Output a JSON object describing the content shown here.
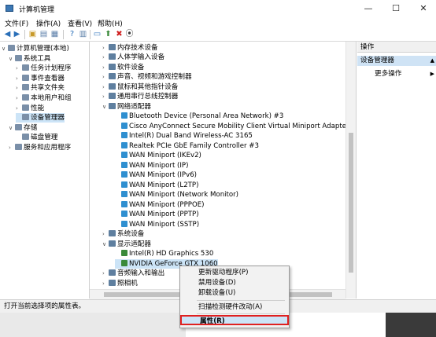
{
  "window": {
    "title": "计算机管理",
    "controls": [
      "—",
      "☐",
      "✕"
    ]
  },
  "menubar": [
    "文件(F)",
    "操作(A)",
    "查看(V)",
    "帮助(H)"
  ],
  "left_tree": [
    {
      "label": "计算机管理(本地)",
      "indent": 0,
      "exp": "∨"
    },
    {
      "label": "系统工具",
      "indent": 1,
      "exp": "∨"
    },
    {
      "label": "任务计划程序",
      "indent": 2,
      "exp": "›"
    },
    {
      "label": "事件查看器",
      "indent": 2,
      "exp": "›"
    },
    {
      "label": "共享文件夹",
      "indent": 2,
      "exp": "›"
    },
    {
      "label": "本地用户和组",
      "indent": 2,
      "exp": "›"
    },
    {
      "label": "性能",
      "indent": 2,
      "exp": "›"
    },
    {
      "label": "设备管理器",
      "indent": 2,
      "exp": "",
      "selected": true
    },
    {
      "label": "存储",
      "indent": 1,
      "exp": "∨"
    },
    {
      "label": "磁盘管理",
      "indent": 2,
      "exp": ""
    },
    {
      "label": "服务和应用程序",
      "indent": 1,
      "exp": "›"
    }
  ],
  "device_tree": [
    {
      "label": "内存技术设备",
      "indent": 0,
      "exp": "›"
    },
    {
      "label": "人体学输入设备",
      "indent": 0,
      "exp": "›"
    },
    {
      "label": "软件设备",
      "indent": 0,
      "exp": "›"
    },
    {
      "label": "声音、视频和游戏控制器",
      "indent": 0,
      "exp": "›"
    },
    {
      "label": "鼠标和其他指针设备",
      "indent": 0,
      "exp": "›"
    },
    {
      "label": "通用串行总线控制器",
      "indent": 0,
      "exp": "›"
    },
    {
      "label": "网络适配器",
      "indent": 0,
      "exp": "∨"
    },
    {
      "label": "Bluetooth Device (Personal Area Network) #3",
      "indent": 1,
      "exp": "",
      "icon": "net"
    },
    {
      "label": "Cisco AnyConnect Secure Mobility Client Virtual Miniport Adapte",
      "indent": 1,
      "exp": "",
      "icon": "net"
    },
    {
      "label": "Intel(R) Dual Band Wireless-AC 3165",
      "indent": 1,
      "exp": "",
      "icon": "net"
    },
    {
      "label": "Realtek PCIe GbE Family Controller #3",
      "indent": 1,
      "exp": "",
      "icon": "net"
    },
    {
      "label": "WAN Miniport (IKEv2)",
      "indent": 1,
      "exp": "",
      "icon": "net"
    },
    {
      "label": "WAN Miniport (IP)",
      "indent": 1,
      "exp": "",
      "icon": "net"
    },
    {
      "label": "WAN Miniport (IPv6)",
      "indent": 1,
      "exp": "",
      "icon": "net"
    },
    {
      "label": "WAN Miniport (L2TP)",
      "indent": 1,
      "exp": "",
      "icon": "net"
    },
    {
      "label": "WAN Miniport (Network Monitor)",
      "indent": 1,
      "exp": "",
      "icon": "net"
    },
    {
      "label": "WAN Miniport (PPPOE)",
      "indent": 1,
      "exp": "",
      "icon": "net"
    },
    {
      "label": "WAN Miniport (PPTP)",
      "indent": 1,
      "exp": "",
      "icon": "net"
    },
    {
      "label": "WAN Miniport (SSTP)",
      "indent": 1,
      "exp": "",
      "icon": "net"
    },
    {
      "label": "系统设备",
      "indent": 0,
      "exp": "›"
    },
    {
      "label": "显示适配器",
      "indent": 0,
      "exp": "∨"
    },
    {
      "label": "Intel(R) HD Graphics 530",
      "indent": 1,
      "exp": "",
      "icon": "gpu"
    },
    {
      "label": "NVIDIA GeForce GTX 1060",
      "indent": 1,
      "exp": "",
      "icon": "gpu",
      "selected": true
    },
    {
      "label": "音频输入和输出",
      "indent": 0,
      "exp": "›"
    },
    {
      "label": "照相机",
      "indent": 0,
      "exp": "›"
    }
  ],
  "actions": {
    "header": "操作",
    "section": "设备管理器",
    "more": "更多操作"
  },
  "context_menu": {
    "update_driver": "更新驱动程序(P)",
    "disable": "禁用设备(D)",
    "uninstall": "卸载设备(U)",
    "scan": "扫描检测硬件改动(A)",
    "properties": "属性(R)"
  },
  "status": "打开当前选择项的属性表。"
}
